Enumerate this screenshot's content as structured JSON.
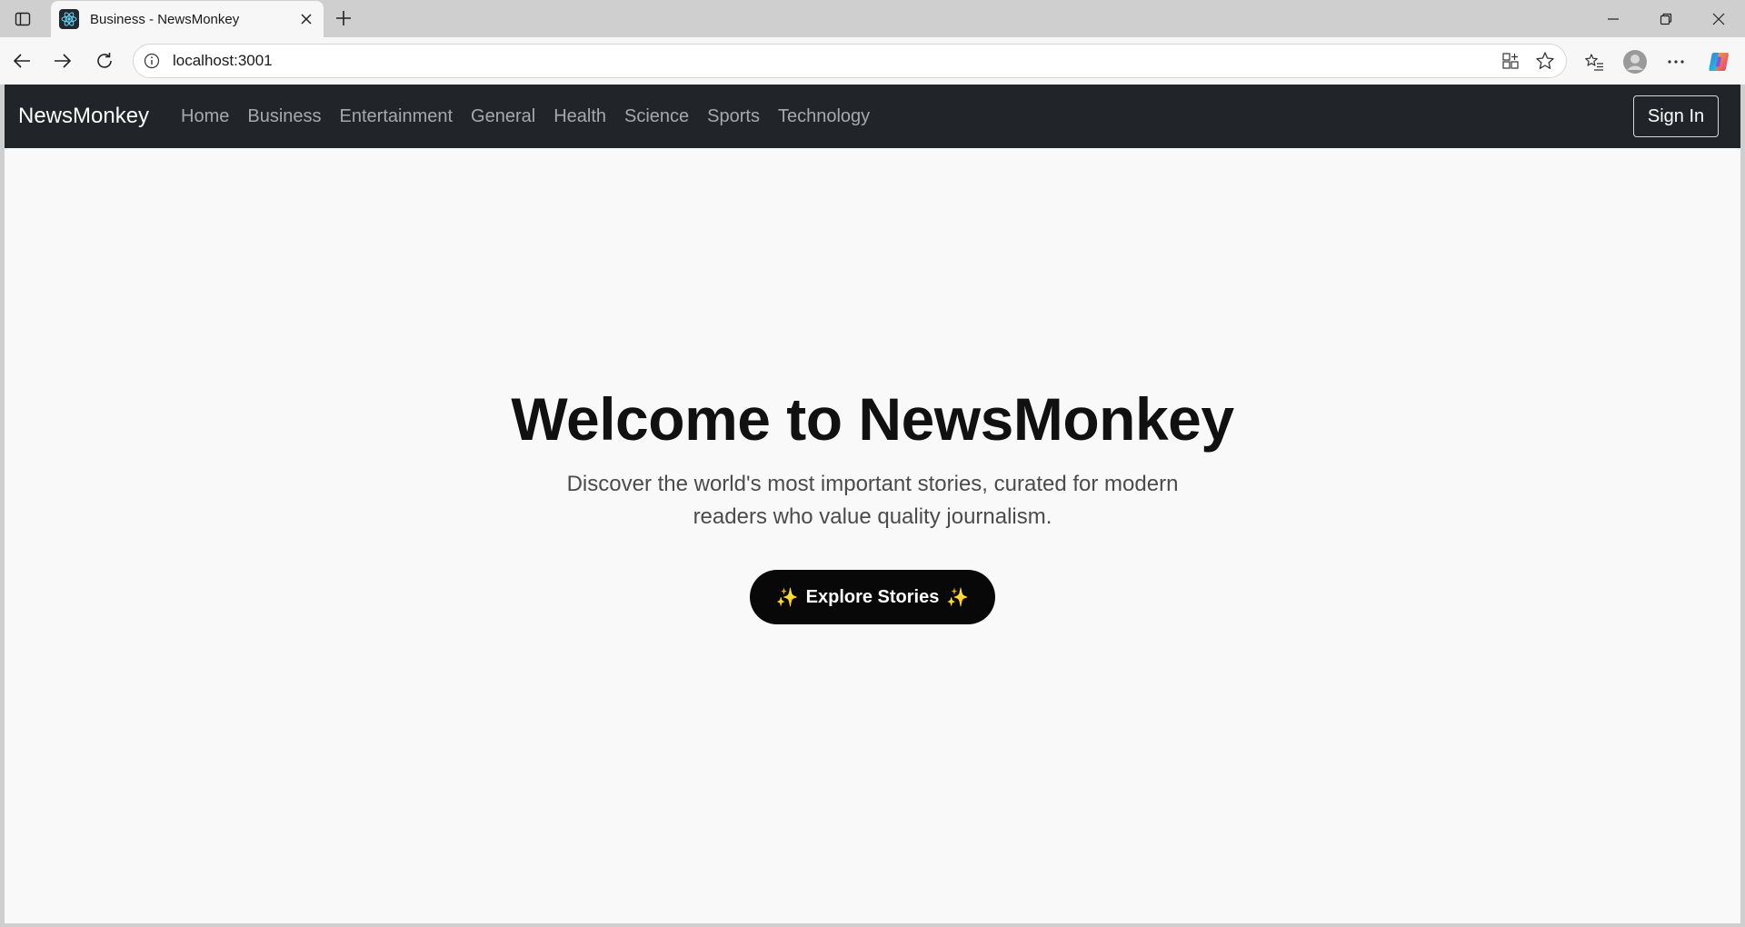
{
  "browser": {
    "tab": {
      "title": "Business - NewsMonkey"
    },
    "address": {
      "url": "localhost:3001"
    }
  },
  "page": {
    "navbar": {
      "brand": "NewsMonkey",
      "links": [
        "Home",
        "Business",
        "Entertainment",
        "General",
        "Health",
        "Science",
        "Sports",
        "Technology"
      ],
      "signin_label": "Sign In"
    },
    "hero": {
      "title": "Welcome to NewsMonkey",
      "subtitle": "Discover the world's most important stories, curated for modern readers who value quality journalism.",
      "cta_label": "Explore Stories",
      "cta_sparkle": "✨"
    }
  },
  "colors": {
    "navbar_bg": "#212529",
    "page_bg": "#f9f9f9",
    "cta_bg": "#080808",
    "sparkle": "#f2b43c"
  },
  "icons": [
    "sidebar-toggle-icon",
    "react-favicon-icon",
    "close-icon",
    "plus-icon",
    "minimize-icon",
    "restore-icon",
    "back-icon",
    "forward-icon",
    "refresh-icon",
    "info-icon",
    "app-available-icon",
    "favorite-star-icon",
    "favorites-list-icon",
    "profile-icon",
    "more-icon",
    "copilot-icon"
  ]
}
